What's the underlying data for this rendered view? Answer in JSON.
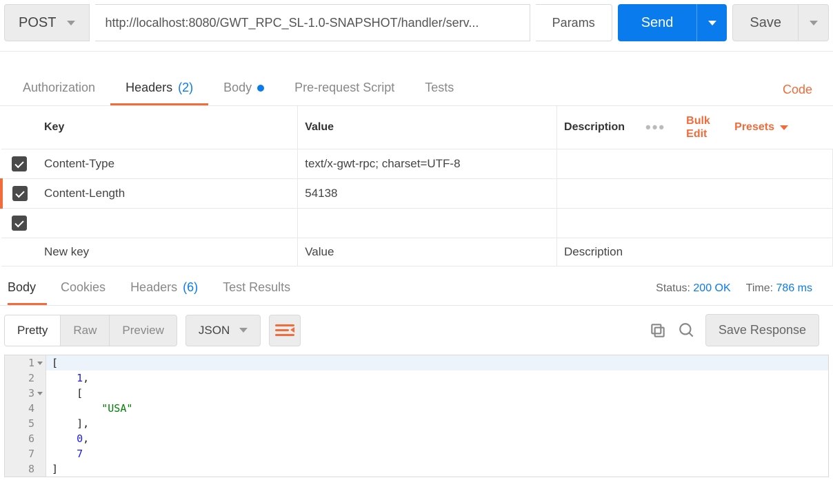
{
  "request": {
    "method": "POST",
    "url": "http://localhost:8080/GWT_RPC_SL-1.0-SNAPSHOT/handler/serv...",
    "params_label": "Params",
    "send_label": "Send",
    "save_label": "Save"
  },
  "req_tabs": {
    "authorization": "Authorization",
    "headers": "Headers",
    "headers_count": "(2)",
    "body": "Body",
    "prerequest": "Pre-request Script",
    "tests": "Tests",
    "code": "Code"
  },
  "headers_table": {
    "col_key": "Key",
    "col_value": "Value",
    "col_description": "Description",
    "bulk_edit": "Bulk Edit",
    "presets": "Presets",
    "placeholder_key": "New key",
    "placeholder_value": "Value",
    "placeholder_desc": "Description",
    "rows": [
      {
        "key": "Content-Type",
        "value": "text/x-gwt-rpc; charset=UTF-8"
      },
      {
        "key": "Content-Length",
        "value": "54138"
      }
    ]
  },
  "resp_tabs": {
    "body": "Body",
    "cookies": "Cookies",
    "headers": "Headers",
    "headers_count": "(6)",
    "tests": "Test Results"
  },
  "resp_meta": {
    "status_label": "Status:",
    "status_value": "200 OK",
    "time_label": "Time:",
    "time_value": "786 ms"
  },
  "resp_toolbar": {
    "pretty": "Pretty",
    "raw": "Raw",
    "preview": "Preview",
    "format": "JSON",
    "save_response": "Save Response"
  },
  "code": {
    "lines": [
      {
        "n": "1",
        "indent": "",
        "tokens": [
          {
            "t": "[",
            "c": "punct"
          }
        ],
        "fold": true
      },
      {
        "n": "2",
        "indent": "    ",
        "tokens": [
          {
            "t": "1",
            "c": "num"
          },
          {
            "t": ",",
            "c": "punct"
          }
        ]
      },
      {
        "n": "3",
        "indent": "    ",
        "tokens": [
          {
            "t": "[",
            "c": "punct"
          }
        ],
        "fold": true
      },
      {
        "n": "4",
        "indent": "        ",
        "tokens": [
          {
            "t": "\"USA\"",
            "c": "str"
          }
        ]
      },
      {
        "n": "5",
        "indent": "    ",
        "tokens": [
          {
            "t": "]",
            "c": "punct"
          },
          {
            "t": ",",
            "c": "punct"
          }
        ]
      },
      {
        "n": "6",
        "indent": "    ",
        "tokens": [
          {
            "t": "0",
            "c": "num"
          },
          {
            "t": ",",
            "c": "punct"
          }
        ]
      },
      {
        "n": "7",
        "indent": "    ",
        "tokens": [
          {
            "t": "7",
            "c": "num"
          }
        ]
      },
      {
        "n": "8",
        "indent": "",
        "tokens": [
          {
            "t": "]",
            "c": "punct"
          }
        ]
      }
    ]
  }
}
